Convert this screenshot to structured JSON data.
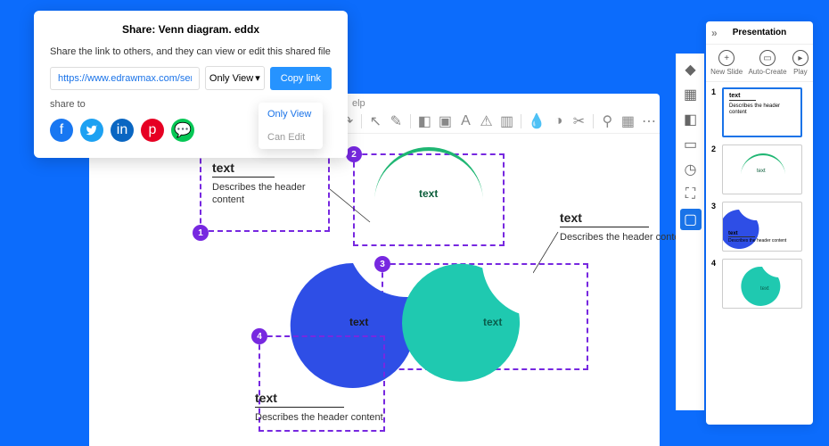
{
  "share": {
    "title": "Share: Venn diagram. eddx",
    "desc": "Share the link to others, and they can view or edit this shared file",
    "link": "https://www.edrawmax.com/server...",
    "perm_label": "Only View",
    "copy_label": "Copy link",
    "share_to_label": "share to",
    "social": {
      "facebook": "#1877f2",
      "twitter": "#1da1f2",
      "linkedin": "#0a66c2",
      "pinterest": "#e60023",
      "line": "#06c755"
    },
    "dropdown": {
      "only_view": "Only View",
      "can_edit": "Can Edit"
    }
  },
  "help_label": "elp",
  "nodes": {
    "n1": {
      "header": "text",
      "body": "Describes the header content"
    },
    "n2": {
      "label": "text"
    },
    "n3": {
      "header": "text",
      "body": "Describes the header content",
      "shape1": "text",
      "shape2": "text"
    },
    "n4": {
      "header": "text",
      "body": "Describes the header content"
    }
  },
  "presentation": {
    "title": "Presentation",
    "actions": {
      "new": "New Slide",
      "auto": "Auto-Create",
      "play": "Play"
    },
    "slides": [
      {
        "num": "1",
        "header": "text",
        "body": "Describes the header content"
      },
      {
        "num": "2",
        "label": "text"
      },
      {
        "num": "3",
        "header": "text",
        "body": "Describes the header content"
      },
      {
        "num": "4",
        "label": "text"
      }
    ]
  }
}
